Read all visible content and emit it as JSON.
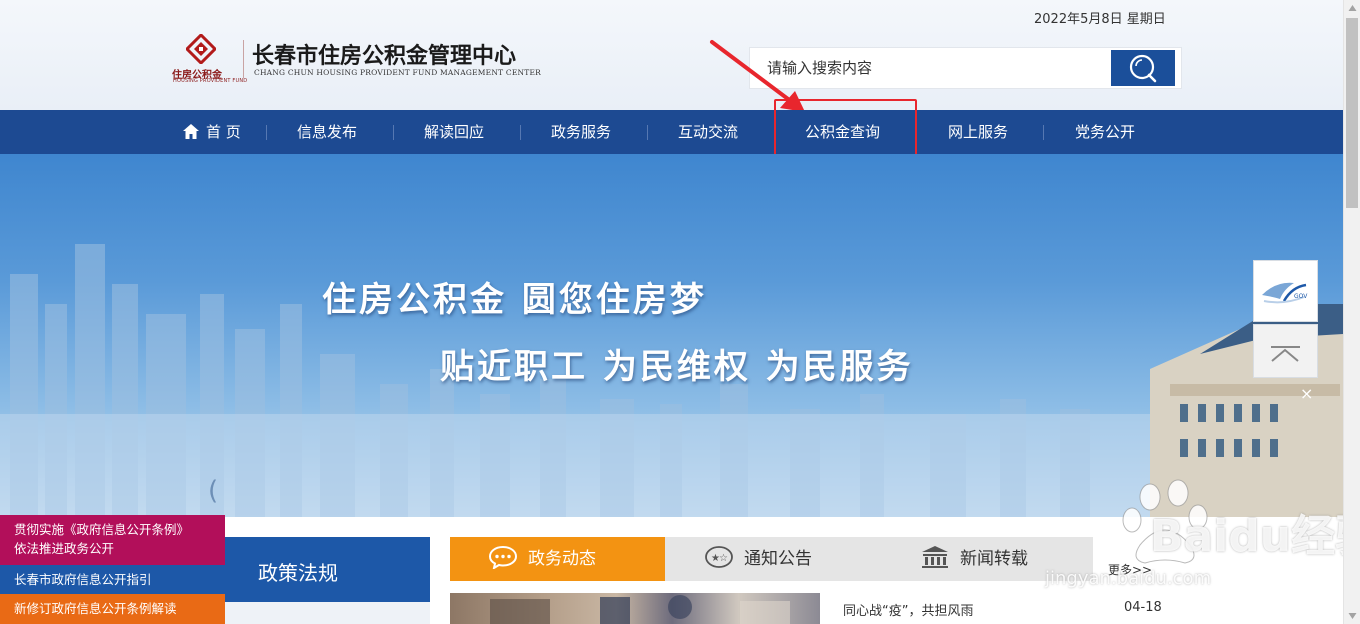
{
  "header": {
    "date": "2022年5月8日 星期日",
    "logo": {
      "name_small": "住房公积金",
      "name_tiny": "HOUSING PROVIDENT FUND",
      "name_cn": "长春市住房公积金管理中心",
      "name_en": "CHANG CHUN HOUSING PROVIDENT FUND MANAGEMENT CENTER",
      "icon": "provident-fund-logo-icon"
    },
    "search": {
      "placeholder": "请输入搜索内容",
      "value": "",
      "icon": "search-icon"
    }
  },
  "nav": {
    "items": [
      {
        "label": "首 页",
        "icon": "home-icon"
      },
      {
        "label": "信息发布"
      },
      {
        "label": "解读回应"
      },
      {
        "label": "政务服务"
      },
      {
        "label": "互动交流"
      },
      {
        "label": "公积金查询",
        "highlighted": true
      },
      {
        "label": "网上服务"
      },
      {
        "label": "党务公开"
      }
    ]
  },
  "banner": {
    "slogan_line1": "住房公积金  圆您住房梦",
    "slogan_line2": "贴近职工  为民维权  为民服务",
    "prev_glyph": "(",
    "gov_badge_text": "GOV",
    "close_glyph": "×"
  },
  "notice_panel": {
    "item1_line1": "贯彻实施《政府信息公开条例》",
    "item1_line2": "依法推进政务公开",
    "item2": "长春市政府信息公开指引",
    "item3": "新修订政府信息公开条例解读"
  },
  "policy": {
    "title": "政策法规"
  },
  "tabs": {
    "items": [
      {
        "label": "政务动态",
        "icon": "chat-bubble-icon",
        "active": true
      },
      {
        "label": "通知公告",
        "icon": "stars-badge-icon"
      },
      {
        "label": "新闻转载",
        "icon": "building-icon"
      }
    ],
    "more": "更多>>"
  },
  "news": {
    "items": [
      {
        "title": "同心战“疫”，共担风雨",
        "date": "04-18"
      }
    ]
  },
  "watermark": {
    "brand": "Baidu经验",
    "url": "jingyan.baidu.com"
  },
  "colors": {
    "nav_blue": "#1d4a92",
    "tab_orange": "#f39312",
    "notice_magenta": "#b20f5a",
    "notice_blue": "#1d58a8",
    "notice_orange": "#e96a15",
    "highlight_red": "#e8262d"
  }
}
